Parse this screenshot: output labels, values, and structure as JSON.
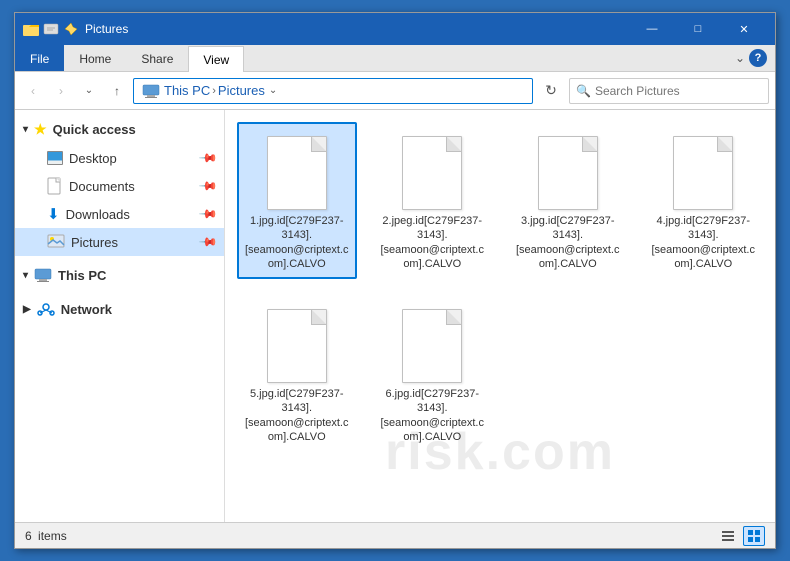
{
  "window": {
    "title": "Pictures",
    "controls": {
      "minimize": "—",
      "maximize": "□",
      "close": "✕"
    }
  },
  "ribbon": {
    "tabs": [
      {
        "id": "file",
        "label": "File"
      },
      {
        "id": "home",
        "label": "Home"
      },
      {
        "id": "share",
        "label": "Share"
      },
      {
        "id": "view",
        "label": "View"
      }
    ]
  },
  "addressbar": {
    "back": "‹",
    "forward": "›",
    "up": "↑",
    "path_thispc": "This PC",
    "path_separator": "›",
    "path_current": "Pictures",
    "refresh": "⟳",
    "search_placeholder": "Search Pictures"
  },
  "sidebar": {
    "quick_access_label": "Quick access",
    "items": [
      {
        "id": "desktop",
        "label": "Desktop",
        "pinned": true
      },
      {
        "id": "documents",
        "label": "Documents",
        "pinned": true
      },
      {
        "id": "downloads",
        "label": "Downloads",
        "pinned": true
      },
      {
        "id": "pictures",
        "label": "Pictures",
        "pinned": true,
        "active": true
      }
    ],
    "thispc_label": "This PC",
    "network_label": "Network"
  },
  "files": [
    {
      "name": "1.jpg.id[C279F237-3143].[seamoon@criptext.com].CALVO",
      "selected": true
    },
    {
      "name": "2.jpeg.id[C279F237-3143].[seamoon@criptext.com].CALVO"
    },
    {
      "name": "3.jpg.id[C279F237-3143].[seamoon@criptext.com].CALVO"
    },
    {
      "name": "4.jpg.id[C279F237-3143].[seamoon@criptext.com].CALVO"
    },
    {
      "name": "5.jpg.id[C279F237-3143].[seamoon@criptext.com].CALVO"
    },
    {
      "name": "6.jpg.id[C279F237-3143].[seamoon@criptext.com].CALVO"
    }
  ],
  "statusbar": {
    "count": "6",
    "items_label": "items"
  },
  "watermark": "risk.com"
}
